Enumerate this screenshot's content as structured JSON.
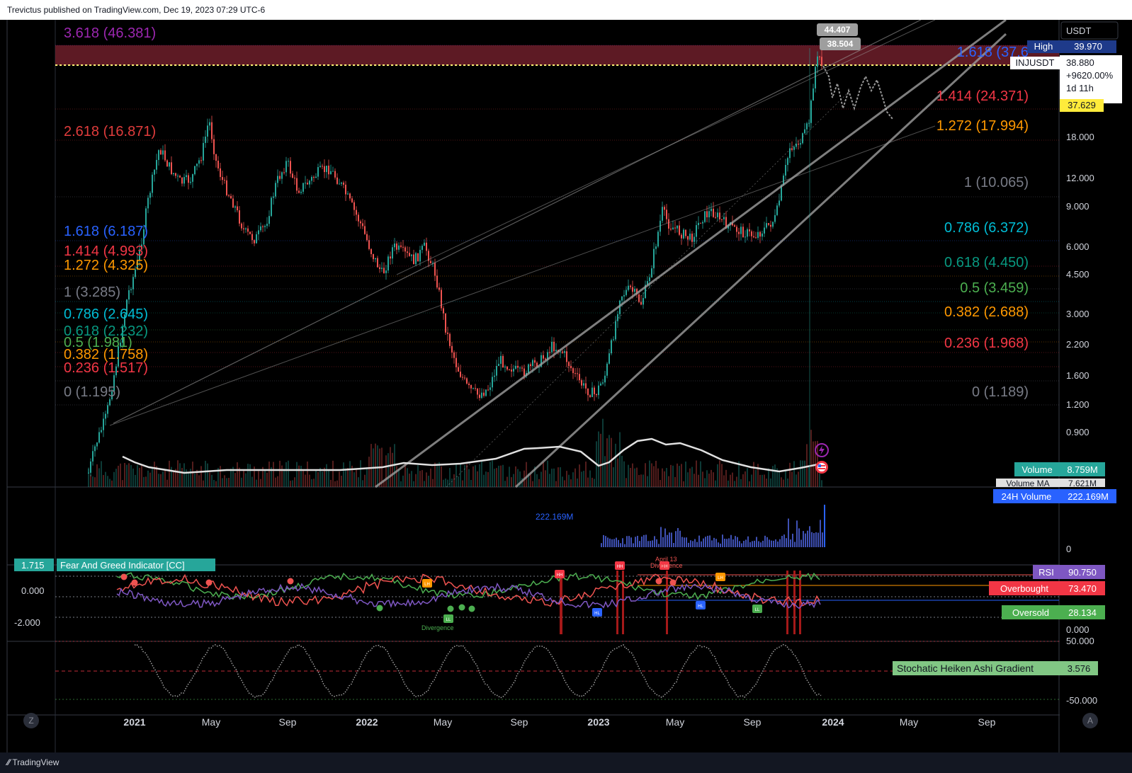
{
  "header": {
    "published_text": "Trevictus published on TradingView.com, Dec 19, 2023 07:29 UTC-6"
  },
  "footer": {
    "brand": "TradingView",
    "brand_icon": "tradingview-logo-icon",
    "z_button": "Z",
    "a_button": "A"
  },
  "price_axis": {
    "currency": "USDT",
    "ticks": [
      "18.000",
      "12.000",
      "9.000",
      "6.000",
      "4.500",
      "3.000",
      "2.200",
      "1.600",
      "1.200",
      "0.900"
    ]
  },
  "price_labels": {
    "high_label": "High",
    "high_value": "39.970",
    "symbol": "INJUSDT",
    "last_price": "38.880",
    "change": "+9620.00%",
    "countdown": "1d 11h",
    "marker_value": "37.629",
    "high_callout": "44.407",
    "close_callout": "38.504"
  },
  "fib_left": [
    {
      "text": "3.618 (46.381)",
      "color": "#9c27b0"
    },
    {
      "text": "2.618 (16.871)",
      "color": "#e03c3c"
    },
    {
      "text": "1.618 (6.187)",
      "color": "#2962ff"
    },
    {
      "text": "1.414 (4.993)",
      "color": "#f23645"
    },
    {
      "text": "1.272 (4.325)",
      "color": "#ff9800"
    },
    {
      "text": "1 (3.285)",
      "color": "#787b86"
    },
    {
      "text": "0.786 (2.645)",
      "color": "#00bcd4"
    },
    {
      "text": "0.618 (2.232)",
      "color": "#089981"
    },
    {
      "text": "0.5 (1.981)",
      "color": "#4caf50"
    },
    {
      "text": "0.382 (1.758)",
      "color": "#ff9800"
    },
    {
      "text": "0.236 (1.517)",
      "color": "#f23645"
    },
    {
      "text": "0 (1.195)",
      "color": "#787b86"
    }
  ],
  "fib_right": [
    {
      "text": "1.618 (37.6",
      "color": "#2962ff"
    },
    {
      "text": "1.414 (24.371)",
      "color": "#f23645"
    },
    {
      "text": "1.272 (17.994)",
      "color": "#ff9800"
    },
    {
      "text": "1 (10.065)",
      "color": "#787b86"
    },
    {
      "text": "0.786 (6.372)",
      "color": "#00bcd4"
    },
    {
      "text": "0.618 (4.450)",
      "color": "#089981"
    },
    {
      "text": "0.5 (3.459)",
      "color": "#4caf50"
    },
    {
      "text": "0.382 (2.688)",
      "color": "#ff9800"
    },
    {
      "text": "0.236 (1.968)",
      "color": "#f23645"
    },
    {
      "text": "0 (1.189)",
      "color": "#787b86"
    }
  ],
  "volume": {
    "label": "Volume",
    "value": "8.759M",
    "ma_label": "Volume MA",
    "ma_value": "7.621M"
  },
  "volume24": {
    "label": "24H Volume",
    "value": "222.169M",
    "chart_label": "222.169M",
    "axis_zero": "0"
  },
  "fear_greed": {
    "title": "Fear And Greed Indicator [CC]",
    "value": "1.715",
    "axis": [
      "0.000",
      "-2.000"
    ],
    "rsi_label": "RSI",
    "rsi_value": "90.750",
    "overbought_label": "Overbought",
    "overbought_value": "73.470",
    "oversold_label": "Oversold",
    "oversold_value": "28.134",
    "rsi_axis_zero": "0.000",
    "annotations": [
      "Divergence",
      "April 13",
      "Divergence"
    ],
    "markers": [
      "LH",
      "HH",
      "HH",
      "HH",
      "LH",
      "HL",
      "LL",
      "HL",
      "LL"
    ]
  },
  "stoch": {
    "title": "Stochatic Heiken Ashi Gradient",
    "value": "3.576",
    "axis_top": "50.000",
    "axis_bottom": "-50.000"
  },
  "time_axis": [
    "2021",
    "May",
    "Sep",
    "2022",
    "May",
    "Sep",
    "2023",
    "May",
    "Sep",
    "2024",
    "May",
    "Sep"
  ],
  "colors": {
    "bull": "#26a69a",
    "bear": "#ef5350",
    "volume_bar": "#3f51b5",
    "rsi": "#7e57c2",
    "accent_label": "#2962ff"
  },
  "icons": [
    "lightning-icon",
    "us-flag-icon"
  ]
}
